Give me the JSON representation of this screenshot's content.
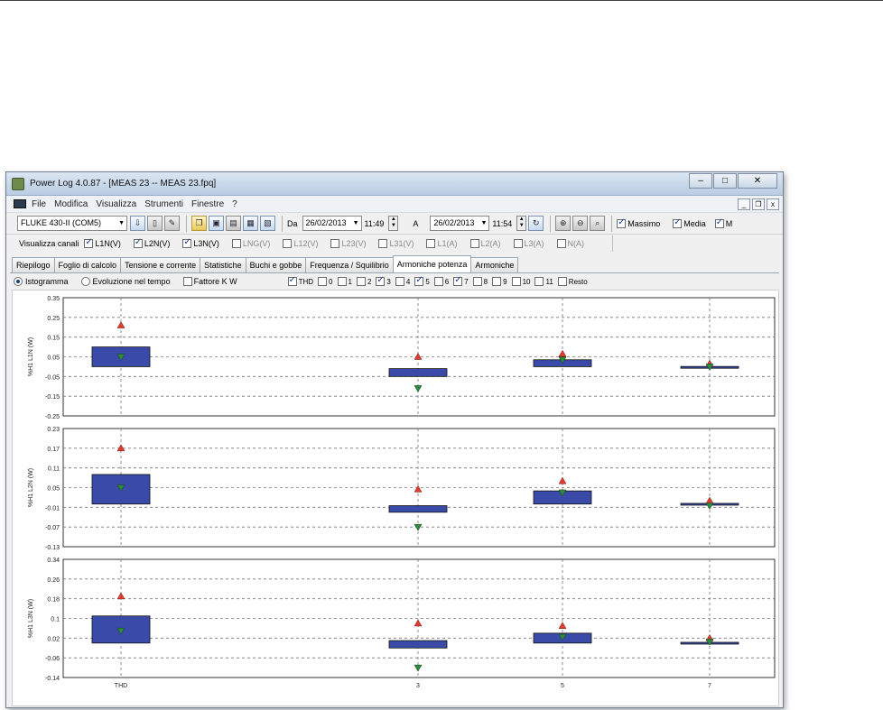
{
  "window": {
    "title": "Power Log 4.0.87 - [MEAS 23 -- MEAS 23.fpq]",
    "controls": [
      "–",
      "□",
      "✕"
    ]
  },
  "menu": [
    "File",
    "Modifica",
    "Visualizza",
    "Strumenti",
    "Finestre",
    "?"
  ],
  "mdi_controls": [
    "_",
    "❐",
    "x"
  ],
  "toolbar": {
    "device": "FLUKE 430-II (COM5)",
    "from_label": "Da",
    "from_date": "26/02/2013",
    "from_time": "11:49",
    "to_label": "A",
    "to_date": "26/02/2013",
    "to_time": "11:54",
    "checks": [
      {
        "label": "Massimo",
        "checked": true
      },
      {
        "label": "Media",
        "checked": true
      },
      {
        "label": "M",
        "checked": true
      }
    ]
  },
  "channels": {
    "label": "Visualizza canali",
    "items": [
      {
        "label": "L1N(V)",
        "checked": true,
        "enabled": true
      },
      {
        "label": "L2N(V)",
        "checked": true,
        "enabled": true
      },
      {
        "label": "L3N(V)",
        "checked": true,
        "enabled": true
      },
      {
        "label": "LNG(V)",
        "checked": false,
        "enabled": false
      },
      {
        "label": "L12(V)",
        "checked": false,
        "enabled": false
      },
      {
        "label": "L23(V)",
        "checked": false,
        "enabled": false
      },
      {
        "label": "L31(V)",
        "checked": false,
        "enabled": false
      },
      {
        "label": "L1(A)",
        "checked": false,
        "enabled": false
      },
      {
        "label": "L2(A)",
        "checked": false,
        "enabled": false
      },
      {
        "label": "L3(A)",
        "checked": false,
        "enabled": false
      },
      {
        "label": "N(A)",
        "checked": false,
        "enabled": false
      }
    ]
  },
  "tabs": [
    {
      "label": "Riepilogo",
      "active": false
    },
    {
      "label": "Foglio di calcolo",
      "active": false
    },
    {
      "label": "Tensione e corrente",
      "active": false
    },
    {
      "label": "Statistiche",
      "active": false
    },
    {
      "label": "Buchi e gobbe",
      "active": false
    },
    {
      "label": "Frequenza / Squilibrio",
      "active": false
    },
    {
      "label": "Armoniche potenza",
      "active": true
    },
    {
      "label": "Armoniche",
      "active": false
    }
  ],
  "options": {
    "istogramma": "Istogramma",
    "evoluzione": "Evoluzione nel tempo",
    "fattore": "Fattore K W",
    "harmonics": [
      {
        "label": "THD",
        "checked": true
      },
      {
        "label": "0",
        "checked": false
      },
      {
        "label": "1",
        "checked": false
      },
      {
        "label": "2",
        "checked": false
      },
      {
        "label": "3",
        "checked": true
      },
      {
        "label": "4",
        "checked": false
      },
      {
        "label": "5",
        "checked": true
      },
      {
        "label": "6",
        "checked": false
      },
      {
        "label": "7",
        "checked": true
      },
      {
        "label": "8",
        "checked": false
      },
      {
        "label": "9",
        "checked": false
      },
      {
        "label": "10",
        "checked": false
      },
      {
        "label": "11",
        "checked": false
      },
      {
        "label": "Resto",
        "checked": false
      }
    ]
  },
  "colors": {
    "bar_fill": "#3a4aa8",
    "max_marker": "#e03c31",
    "min_marker": "#2e8a3c"
  },
  "chart_data": [
    {
      "type": "bar",
      "ylabel": "%H1 L1N (W)",
      "categories": [
        "THD",
        "3",
        "5",
        "7"
      ],
      "ylim": [
        -0.25,
        0.35
      ],
      "yticks": [
        "0.35",
        "0.25",
        "0.15",
        "0.05",
        "-0.05",
        "-0.15",
        "-0.25"
      ],
      "grid": true,
      "bars": [
        {
          "category": "THD",
          "low": 0.0,
          "high": 0.1,
          "avg": 0.05,
          "max": 0.21,
          "min": 0.05
        },
        {
          "category": "3",
          "low": -0.05,
          "high": -0.01,
          "avg": -0.03,
          "max": 0.05,
          "min": -0.11
        },
        {
          "category": "5",
          "low": 0.0,
          "high": 0.035,
          "avg": 0.035,
          "max": 0.065,
          "min": 0.035
        },
        {
          "category": "7",
          "low": -0.001,
          "high": 0.001,
          "avg": 0.0,
          "max": 0.015,
          "min": 0.0
        }
      ]
    },
    {
      "type": "bar",
      "ylabel": "%H1 L2N (W)",
      "categories": [
        "THD",
        "3",
        "5",
        "7"
      ],
      "ylim": [
        -0.13,
        0.23
      ],
      "yticks": [
        "0.23",
        "0.17",
        "0.11",
        "0.05",
        "-0.01",
        "-0.07",
        "-0.13"
      ],
      "grid": true,
      "bars": [
        {
          "category": "THD",
          "low": 0.0,
          "high": 0.09,
          "avg": 0.05,
          "max": 0.17,
          "min": 0.05
        },
        {
          "category": "3",
          "low": -0.025,
          "high": -0.005,
          "avg": -0.015,
          "max": 0.045,
          "min": -0.07
        },
        {
          "category": "5",
          "low": 0.0,
          "high": 0.04,
          "avg": 0.035,
          "max": 0.07,
          "min": 0.035
        },
        {
          "category": "7",
          "low": -0.002,
          "high": 0.002,
          "avg": 0.0,
          "max": 0.01,
          "min": -0.005
        }
      ]
    },
    {
      "type": "bar",
      "ylabel": "%H1 L3N (W)",
      "categories": [
        "THD",
        "3",
        "5",
        "7"
      ],
      "ylim": [
        -0.14,
        0.34
      ],
      "yticks": [
        "0.34",
        "0.26",
        "0.18",
        "0.1",
        "0.02",
        "-0.06",
        "-0.14"
      ],
      "xticks": [
        "THD",
        "3",
        "5",
        "7"
      ],
      "grid": true,
      "bars": [
        {
          "category": "THD",
          "low": 0.0,
          "high": 0.11,
          "avg": 0.05,
          "max": 0.19,
          "min": 0.05
        },
        {
          "category": "3",
          "low": -0.02,
          "high": 0.01,
          "avg": -0.02,
          "max": 0.08,
          "min": -0.1
        },
        {
          "category": "5",
          "low": 0.0,
          "high": 0.04,
          "avg": 0.025,
          "max": 0.07,
          "min": 0.025
        },
        {
          "category": "7",
          "low": -0.003,
          "high": 0.003,
          "avg": 0.0,
          "max": 0.02,
          "min": 0.005
        }
      ]
    }
  ]
}
